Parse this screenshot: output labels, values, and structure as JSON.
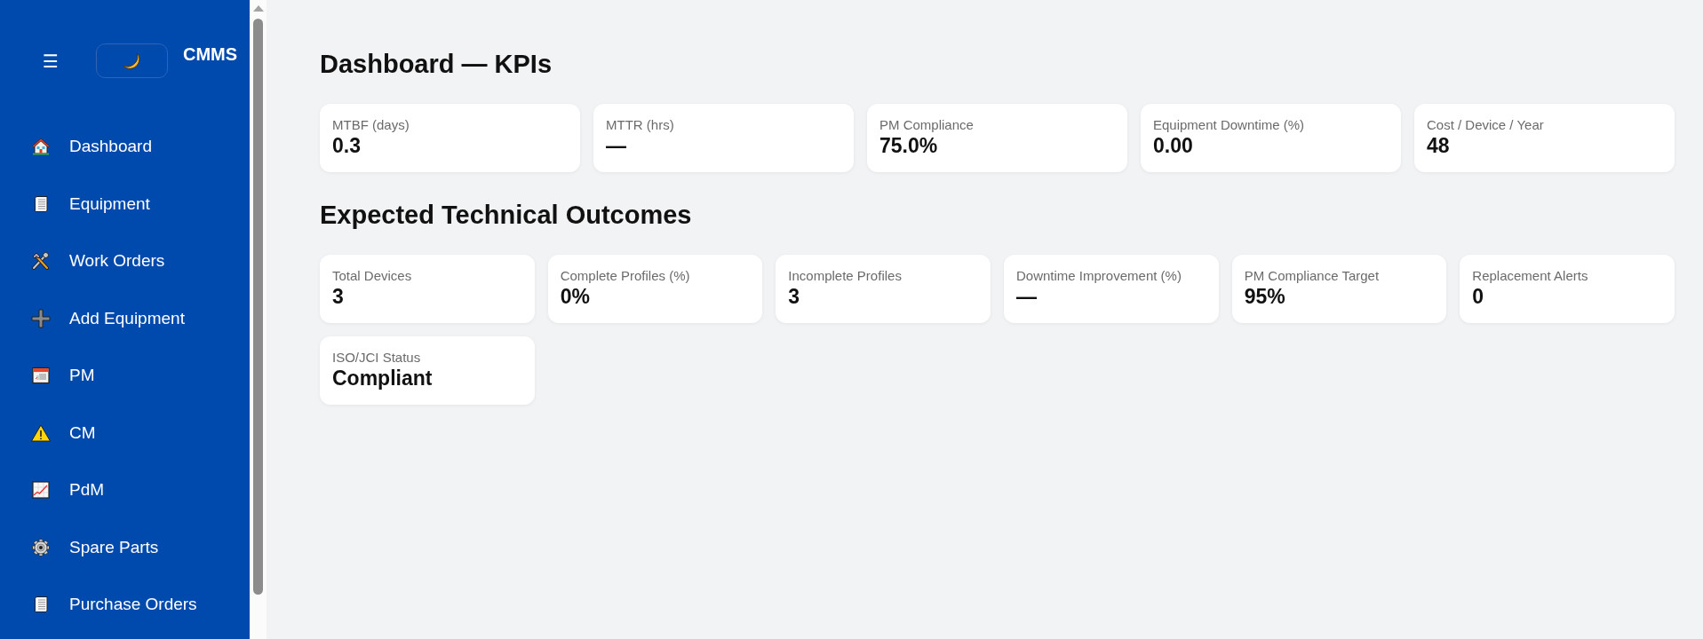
{
  "sidebar": {
    "menu_button": "☰",
    "brand": "CMMS",
    "nav_items": [
      {
        "label": "Dashboard"
      },
      {
        "label": "Equipment"
      },
      {
        "label": "Work Orders"
      },
      {
        "label": "Add Equipment"
      },
      {
        "label": "PM"
      },
      {
        "label": "CM"
      },
      {
        "label": "PdM"
      },
      {
        "label": "Spare Parts"
      },
      {
        "label": "Purchase Orders"
      }
    ]
  },
  "main": {
    "sections": [
      {
        "title": "Dashboard — KPIs",
        "cards": [
          {
            "label": "MTBF (days)",
            "value": "0.3"
          },
          {
            "label": "MTTR (hrs)",
            "value": "—"
          },
          {
            "label": "PM Compliance",
            "value": "75.0%"
          },
          {
            "label": "Equipment Downtime (%)",
            "value": "0.00"
          },
          {
            "label": "Cost / Device / Year",
            "value": "48"
          }
        ]
      },
      {
        "title": "Expected Technical Outcomes",
        "cards": [
          {
            "label": "Total Devices",
            "value": "3"
          },
          {
            "label": "Complete Profiles (%)",
            "value": "0%"
          },
          {
            "label": "Incomplete Profiles",
            "value": "3"
          },
          {
            "label": "Downtime Improvement (%)",
            "value": "—"
          },
          {
            "label": "PM Compliance Target",
            "value": "95%"
          },
          {
            "label": "Replacement Alerts",
            "value": "0"
          },
          {
            "label": "ISO/JCI Status",
            "value": "Compliant"
          }
        ]
      }
    ]
  }
}
